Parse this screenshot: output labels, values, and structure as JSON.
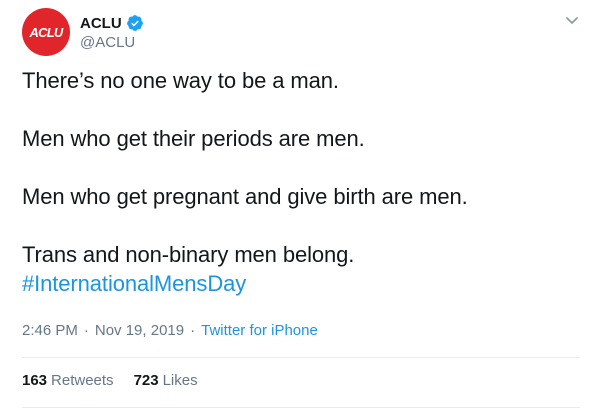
{
  "author": {
    "display_name": "ACLU",
    "handle": "@ACLU",
    "avatar_text": "ACLU",
    "verified": true,
    "verified_icon": "verified-badge-icon"
  },
  "menu": {
    "icon": "chevron-down-icon"
  },
  "tweet": {
    "lines": [
      "There’s no one way to be a man.",
      "Men who get their periods are men.",
      "Men who get pregnant and give birth are men.",
      "Trans and non-binary men belong."
    ],
    "hashtag": "#InternationalMensDay"
  },
  "meta": {
    "time": "2:46 PM",
    "separator": "·",
    "date": "Nov 19, 2019",
    "source": "Twitter for iPhone"
  },
  "stats": {
    "retweets_count": "163",
    "retweets_label": "Retweets",
    "likes_count": "723",
    "likes_label": "Likes"
  },
  "colors": {
    "avatar_bg": "#e0252b",
    "link": "#1b95e0",
    "secondary_text": "#657786",
    "primary_text": "#14171a",
    "divider": "#e6ecf0"
  }
}
